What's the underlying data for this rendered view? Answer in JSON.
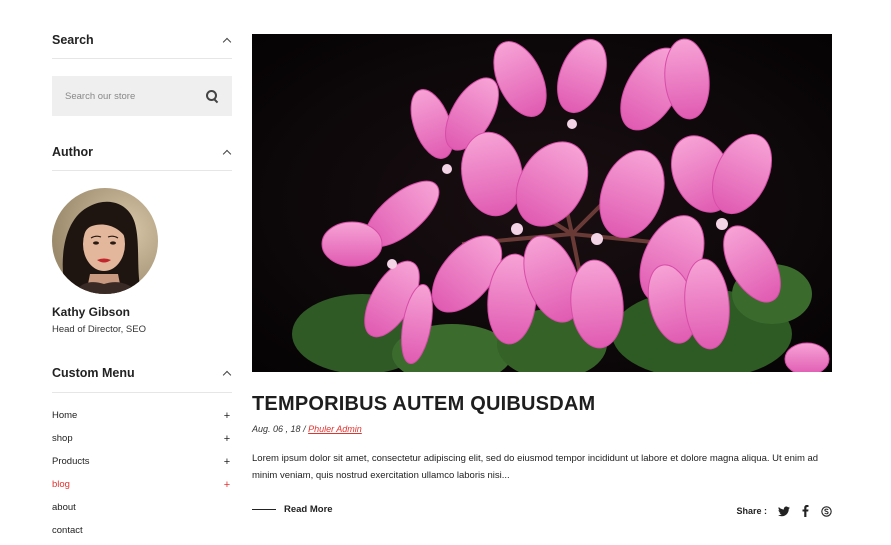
{
  "sidebar": {
    "search": {
      "title": "Search",
      "placeholder": "Search our store"
    },
    "author": {
      "title": "Author",
      "name": "Kathy Gibson",
      "role": "Head of Director, SEO"
    },
    "custom_menu": {
      "title": "Custom Menu",
      "items": [
        {
          "label": "Home",
          "toggle": "+"
        },
        {
          "label": "shop",
          "toggle": "+"
        },
        {
          "label": "Products",
          "toggle": "+"
        },
        {
          "label": "blog",
          "toggle": "+"
        },
        {
          "label": "about"
        },
        {
          "label": "contact"
        }
      ]
    }
  },
  "post": {
    "title": "TEMPORIBUS AUTEM QUIBUSDAM",
    "date": "Aug. 06 , 18",
    "separator": "/",
    "author": "Phuler Admin",
    "excerpt": "Lorem ipsum dolor sit amet, consectetur adipiscing elit, sed do eiusmod tempor incididunt ut labore et dolore magna aliqua. Ut enim ad minim veniam, quis nostrud exercitation ullamco laboris nisi...",
    "read_more": "Read More",
    "share_label": "Share :"
  },
  "icons": {
    "share": [
      "twitter-icon",
      "facebook-icon",
      "skype-icon"
    ]
  },
  "colors": {
    "accent": "#e2332f",
    "search_bg": "#efefef",
    "text": "#222222"
  }
}
